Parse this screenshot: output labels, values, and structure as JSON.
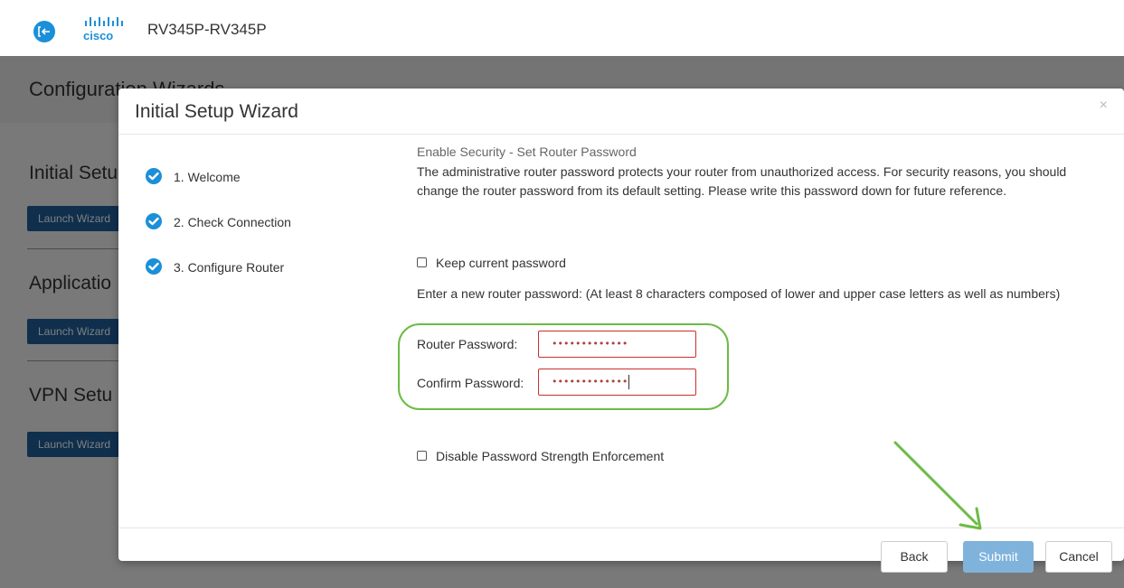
{
  "app": {
    "device_name": "RV345P-RV345P",
    "logo_text": "cisco"
  },
  "background": {
    "page_title": "Configuration Wizards",
    "sections": [
      {
        "title": "Initial Setu",
        "button": "Launch Wizard"
      },
      {
        "title": "Applicatio",
        "button": "Launch Wizard"
      },
      {
        "title": "VPN Setu",
        "button": "Launch Wizard"
      }
    ]
  },
  "modal": {
    "title": "Initial Setup Wizard",
    "close_label": "×",
    "steps": [
      {
        "label": "1. Welcome"
      },
      {
        "label": "2. Check Connection"
      },
      {
        "label": "3. Configure Router"
      }
    ],
    "heading": "Enable Security - Set Router Password",
    "description": "The administrative router password protects your router from unauthorized access. For security reasons, you should change the router password from its default setting. Please write this password down for future reference.",
    "keep_password_label": "Keep current password",
    "instruction": "Enter a new router password: (At least 8 characters composed of lower and upper case letters as well as numbers)",
    "router_password_label": "Router Password:",
    "router_password_value": "•••••••••••••",
    "confirm_password_label": "Confirm Password:",
    "confirm_password_value": "•••••••••••••",
    "disable_strength_label": "Disable Password Strength Enforcement",
    "buttons": {
      "back": "Back",
      "submit": "Submit",
      "cancel": "Cancel"
    }
  },
  "colors": {
    "accent": "#1b8fd8",
    "field_error_border": "#c9302c",
    "annotation_green": "#6dbb45",
    "submit_button": "#7fb3dc",
    "background_button": "#1f5f9a"
  }
}
